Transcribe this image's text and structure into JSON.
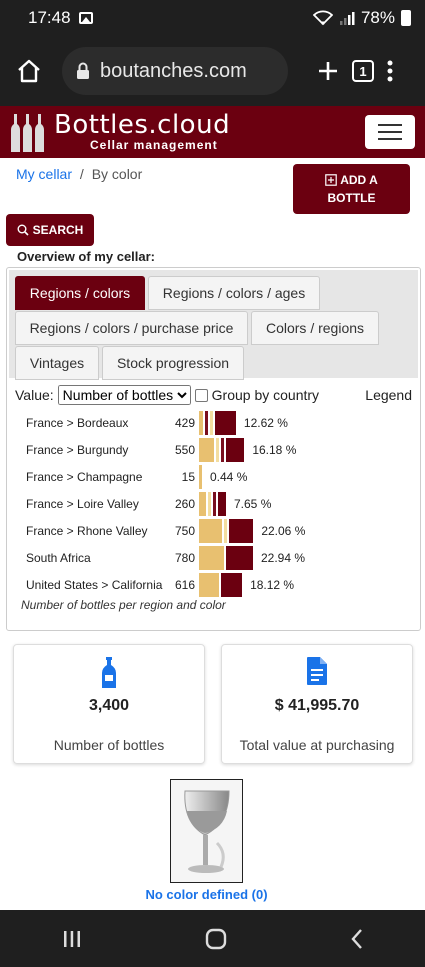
{
  "status": {
    "time": "17:48",
    "battery": "78%"
  },
  "browser": {
    "url": "boutanches.com",
    "tab_count": "1"
  },
  "site": {
    "logo_title": "Bottles.cloud",
    "logo_sub": "Cellar management"
  },
  "breadcrumb": {
    "root": "My cellar",
    "separator": "/",
    "current": "By color"
  },
  "buttons": {
    "add_line1": "ADD A",
    "add_line2": "BOTTLE",
    "search": "SEARCH"
  },
  "overview_title": "Overview of my cellar:",
  "tabs": [
    "Regions / colors",
    "Regions / colors / ages",
    "Regions / colors / purchase price",
    "Colors / regions",
    "Vintages",
    "Stock progression"
  ],
  "controls": {
    "value_label": "Value:",
    "value_selected": "Number of bottles",
    "group_label": "Group by country",
    "legend_label": "Legend"
  },
  "chart_data": {
    "type": "bar",
    "categories": [
      "France > Bordeaux",
      "France > Burgundy",
      "France > Champagne",
      "France > Loire Valley",
      "France > Rhone Valley",
      "South Africa",
      "United States > California"
    ],
    "totals": [
      429,
      550,
      15,
      260,
      750,
      780,
      616
    ],
    "percent_labels": [
      "12.62 %",
      "16.18 %",
      "0.44 %",
      "7.65 %",
      "22.06 %",
      "22.94 %",
      "18.12 %"
    ],
    "segments": [
      [
        {
          "color": "#e8c070",
          "value": 60
        },
        {
          "color": "#7a0f1f",
          "value": 20
        },
        {
          "color": "#f3dda0",
          "value": 35
        },
        {
          "color": "#6b0010",
          "value": 314
        }
      ],
      [
        {
          "color": "#e8c070",
          "value": 220
        },
        {
          "color": "#f3dda0",
          "value": 30
        },
        {
          "color": "#7a0f1f",
          "value": 20
        },
        {
          "color": "#6b0010",
          "value": 280
        }
      ],
      [
        {
          "color": "#e8c070",
          "value": 15
        }
      ],
      [
        {
          "color": "#e8c070",
          "value": 100
        },
        {
          "color": "#f3dda0",
          "value": 25
        },
        {
          "color": "#7a0f1f",
          "value": 10
        },
        {
          "color": "#6b0010",
          "value": 125
        }
      ],
      [
        {
          "color": "#e8c070",
          "value": 340
        },
        {
          "color": "#f3dda0",
          "value": 40
        },
        {
          "color": "#6b0010",
          "value": 370
        }
      ],
      [
        {
          "color": "#e8c070",
          "value": 370
        },
        {
          "color": "#6b0010",
          "value": 410
        }
      ],
      [
        {
          "color": "#e8c070",
          "value": 296
        },
        {
          "color": "#6b0010",
          "value": 320
        }
      ]
    ],
    "caption": "Number of bottles per region and color"
  },
  "stats": {
    "bottles_value": "3,400",
    "bottles_label": "Number of bottles",
    "value_value": "$ 41,995.70",
    "value_label": "Total value at purchasing"
  },
  "no_color": "No color defined (0)"
}
